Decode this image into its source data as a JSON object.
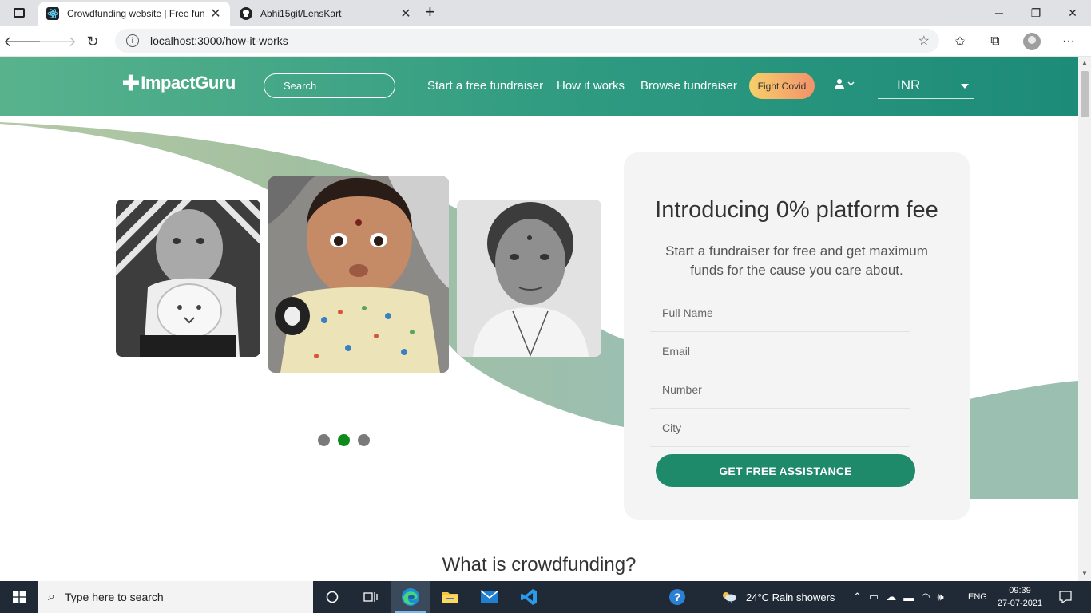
{
  "browser": {
    "tabs": [
      {
        "title": "Crowdfunding website | Free fun",
        "active": true
      },
      {
        "title": "Abhi15git/LensKart",
        "active": false
      }
    ],
    "url": "localhost:3000/how-it-works"
  },
  "site": {
    "logo_text": "ImpactGuru",
    "search_placeholder": "Search",
    "nav": {
      "start": "Start a free fundraiser",
      "how": "How it works",
      "browse": "Browse fundraiser"
    },
    "fight_covid": "Fight Covid",
    "currency": "INR"
  },
  "hero": {
    "carousel_active_index": 2,
    "carousel_dot_count": 3
  },
  "form": {
    "title": "Introducing 0% platform fee",
    "subtitle": "Start a fundraiser for free and get maximum funds for the cause you care about.",
    "fields": {
      "full_name": "Full Name",
      "email": "Email",
      "number": "Number",
      "city": "City"
    },
    "cta": "GET FREE ASSISTANCE"
  },
  "section": {
    "title": "What is crowdfunding?"
  },
  "taskbar": {
    "search_placeholder": "Type here to search",
    "weather": "24°C  Rain showers",
    "lang": "ENG",
    "time": "09:39",
    "date": "27-07-2021"
  },
  "colors": {
    "header_start": "#58b38d",
    "header_end": "#1c8b78",
    "cta": "#1f8a6a",
    "dot_active": "#0d8a1b"
  }
}
